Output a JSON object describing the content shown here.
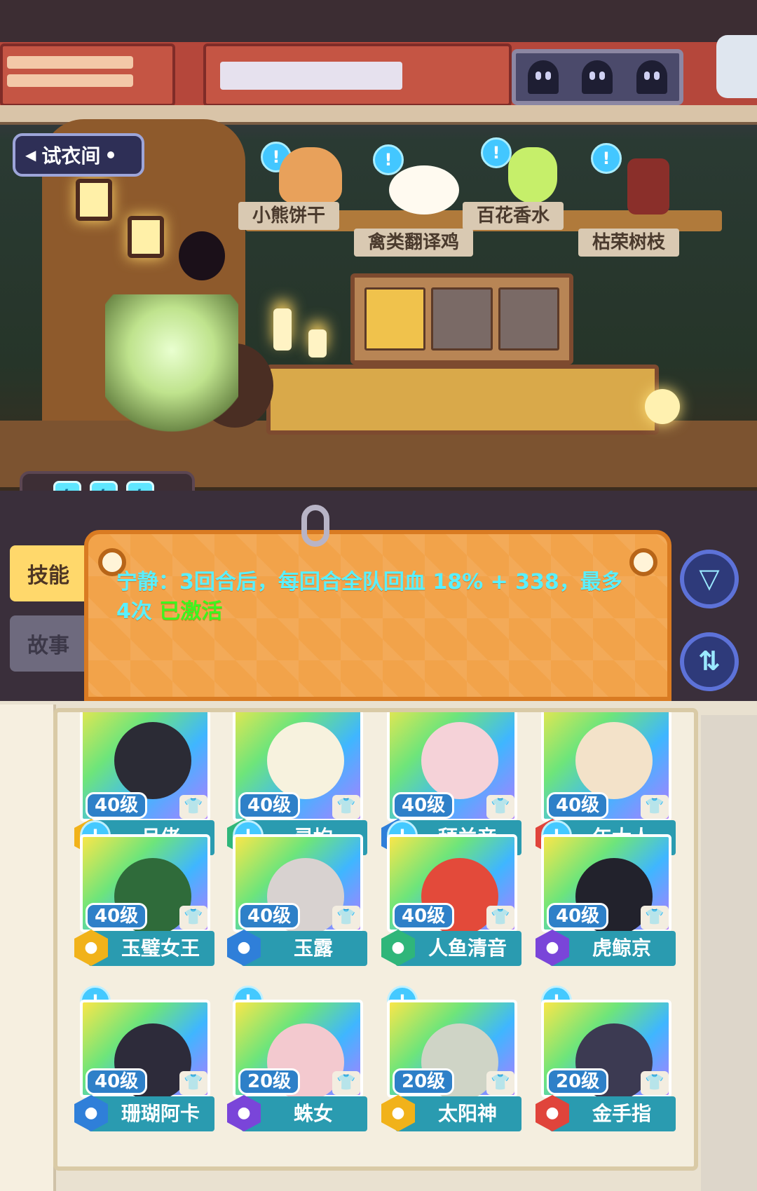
{
  "scene": {
    "fitting_room_label": "试衣间",
    "items": [
      {
        "name": "小熊饼干"
      },
      {
        "name": "禽类翻译鸡"
      },
      {
        "name": "百花香水"
      },
      {
        "name": "枯荣树枝"
      }
    ],
    "energy_icons": [
      "lightning-icon",
      "lightning-icon",
      "lightning-icon"
    ]
  },
  "panel": {
    "tabs": {
      "skill": "技能",
      "story": "故事"
    },
    "skill_description": "宁静：3回合后，每回合全队回血 18% + 338，最多4次",
    "skill_status": "已激活",
    "buttons": {
      "filter_icon": "filter-icon",
      "sort_icon": "sort-icon"
    }
  },
  "roster": [
    {
      "level": "40级",
      "name": "月佬",
      "badge": "gold"
    },
    {
      "level": "40级",
      "name": "灵均",
      "badge": "green"
    },
    {
      "level": "40级",
      "name": "拜兰帝",
      "badge": "blue"
    },
    {
      "level": "40级",
      "name": "年大人",
      "badge": "red"
    },
    {
      "level": "40级",
      "name": "玉璧女王",
      "badge": "gold"
    },
    {
      "level": "40级",
      "name": "玉露",
      "badge": "blue"
    },
    {
      "level": "40级",
      "name": "人鱼清音",
      "badge": "green"
    },
    {
      "level": "40级",
      "name": "虎鲸京",
      "badge": "purple"
    },
    {
      "level": "40级",
      "name": "珊瑚阿卡",
      "badge": "blue"
    },
    {
      "level": "20级",
      "name": "蛛女",
      "badge": "purple"
    },
    {
      "level": "20级",
      "name": "太阳神",
      "badge": "gold"
    },
    {
      "level": "20级",
      "name": "金手指",
      "badge": "red"
    }
  ],
  "colors": {
    "badge_gold": "#f1b21a",
    "badge_green": "#2fb67a",
    "badge_blue": "#2f7fd9",
    "badge_red": "#e0443b",
    "badge_purple": "#7a45d9",
    "skill_text": "#59f0ff",
    "skill_active": "#3cf51f"
  }
}
